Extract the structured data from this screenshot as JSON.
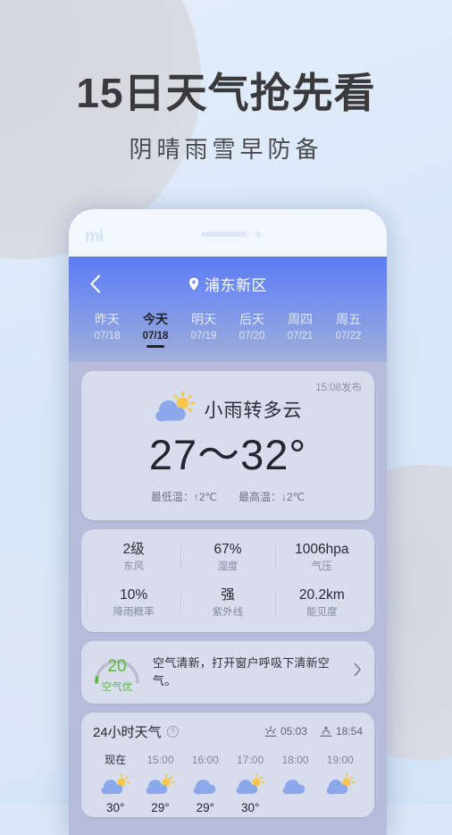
{
  "promo": {
    "title": "15日天气抢先看",
    "subtitle": "阴晴雨雪早防备"
  },
  "phone": {
    "brand_logo": "mi"
  },
  "app": {
    "header": {
      "back_icon": "chevron-left-icon",
      "location_icon": "location-pin-icon",
      "location": "浦东新区"
    },
    "day_tabs": [
      {
        "label": "昨天",
        "date": "07/18",
        "active": false
      },
      {
        "label": "今天",
        "date": "07/18",
        "active": true
      },
      {
        "label": "明天",
        "date": "07/19",
        "active": false
      },
      {
        "label": "后天",
        "date": "07/20",
        "active": false
      },
      {
        "label": "周四",
        "date": "07/21",
        "active": false
      },
      {
        "label": "周五",
        "date": "07/22",
        "active": false
      }
    ],
    "current": {
      "publish_time": "15:08发布",
      "condition_icon": "sun-behind-cloud-icon",
      "condition": "小雨转多云",
      "temperature_range": "27～32°",
      "low_delta_label": "最低温：↑2℃",
      "high_delta_label": "最高温：↓2℃"
    },
    "metrics": [
      {
        "value": "2级",
        "label": "东风"
      },
      {
        "value": "67%",
        "label": "湿度"
      },
      {
        "value": "1006hpa",
        "label": "气压"
      },
      {
        "value": "10%",
        "label": "降雨概率"
      },
      {
        "value": "强",
        "label": "紫外线"
      },
      {
        "value": "20.2km",
        "label": "能见度"
      }
    ],
    "air_quality": {
      "aqi": "20",
      "level": "空气优",
      "advice": "空气清新，打开窗户呼吸下清新空气。",
      "arrow_icon": "chevron-right-icon",
      "accent_color": "#5cb83c",
      "track_color": "#b8bccb"
    },
    "hourly": {
      "title": "24小时天气",
      "help_icon": "question-mark-icon",
      "sunrise_icon": "sunrise-icon",
      "sunrise": "05:03",
      "sunset_icon": "sunset-icon",
      "sunset": "18:54",
      "items": [
        {
          "time": "现在",
          "icon": "sun-behind-cloud-icon",
          "temp": "30°",
          "is_now": true
        },
        {
          "time": "15:00",
          "icon": "sun-behind-cloud-icon",
          "temp": "29°",
          "is_now": false
        },
        {
          "time": "16:00",
          "icon": "cloud-icon",
          "temp": "29°",
          "is_now": false
        },
        {
          "time": "17:00",
          "icon": "sun-behind-cloud-icon",
          "temp": "30°",
          "is_now": false
        },
        {
          "time": "18:00",
          "icon": "cloud-icon",
          "temp": "",
          "is_now": false
        },
        {
          "time": "19:00",
          "icon": "sun-behind-cloud-icon",
          "temp": "",
          "is_now": false
        }
      ]
    }
  },
  "colors": {
    "page_bg": "#dce8f7",
    "header_top": "#5a7cf0",
    "header_bottom": "#a3b0da",
    "screen_bg": "#b5bdda",
    "card_bg": "#d7ddec",
    "cloud_blue": "#8aa8ea",
    "sun_yellow": "#f7c64a"
  }
}
